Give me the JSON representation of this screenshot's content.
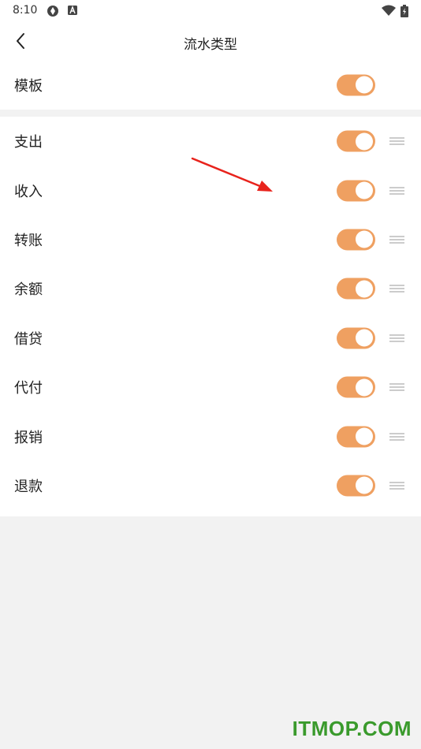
{
  "status_bar": {
    "time": "8:10"
  },
  "header": {
    "title": "流水类型"
  },
  "template": {
    "label": "模板",
    "enabled": true
  },
  "types": [
    {
      "label": "支出",
      "enabled": true
    },
    {
      "label": "收入",
      "enabled": true
    },
    {
      "label": "转账",
      "enabled": true
    },
    {
      "label": "余额",
      "enabled": true
    },
    {
      "label": "借贷",
      "enabled": true
    },
    {
      "label": "代付",
      "enabled": true
    },
    {
      "label": "报销",
      "enabled": true
    },
    {
      "label": "退款",
      "enabled": true
    }
  ],
  "colors": {
    "toggle_on": "#efa061",
    "arrow": "#e8231c",
    "watermark": "#3a9a2c"
  },
  "watermark": "ITMOP.COM"
}
